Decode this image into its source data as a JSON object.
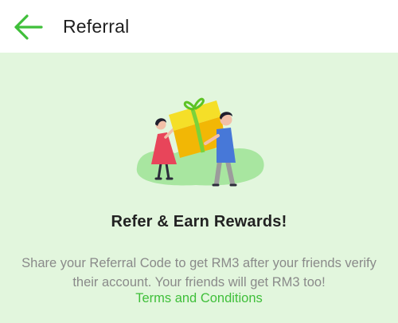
{
  "header": {
    "title": "Referral",
    "back_icon": "arrow-left-icon",
    "accent_color": "#3fbf3a"
  },
  "main": {
    "illustration": "gift-exchange-illustration",
    "headline": "Refer & Earn Rewards!",
    "description": "Share your Referral Code to get RM3 after your friends verify their account. Your friends will get RM3 too!",
    "terms_link": "Terms and Conditions",
    "background_color": "#e2f6dd"
  }
}
